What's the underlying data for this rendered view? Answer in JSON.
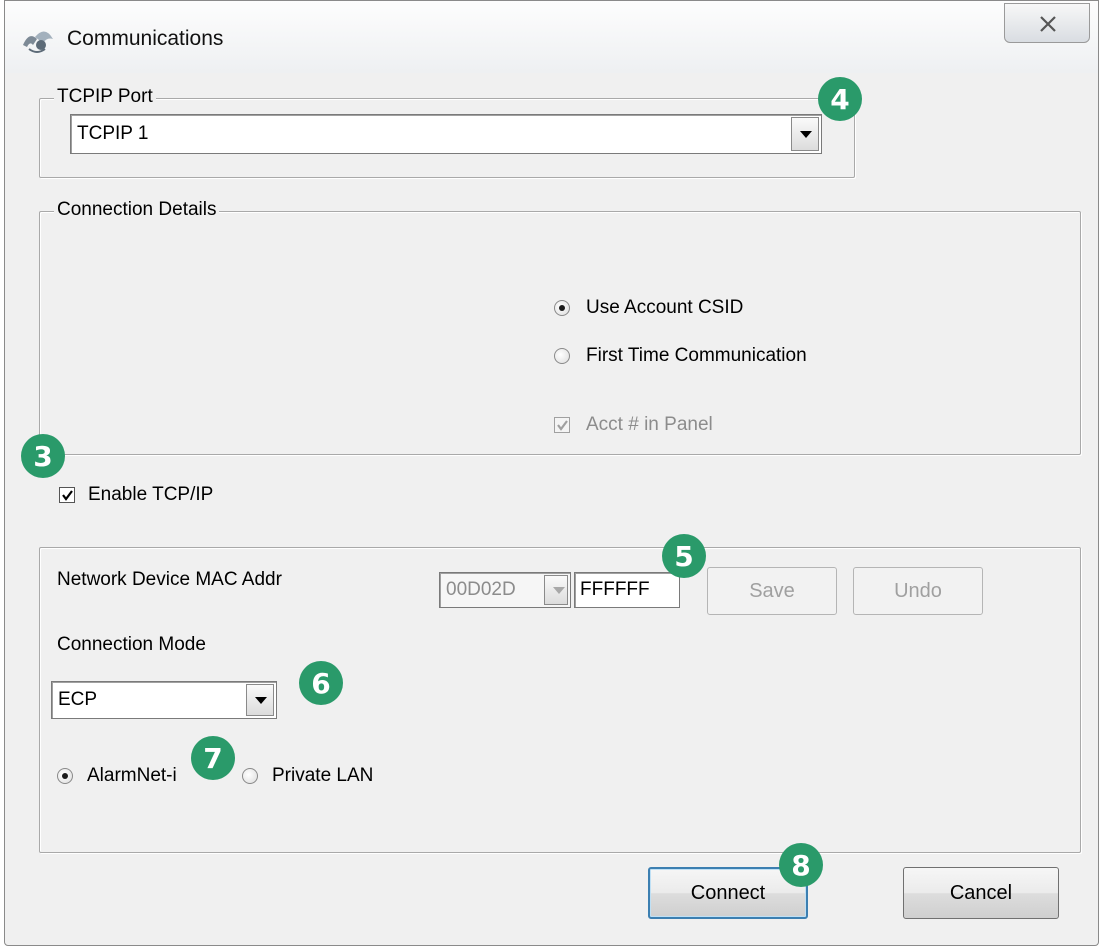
{
  "window": {
    "title": "Communications"
  },
  "tcpip_port": {
    "legend": "TCPIP Port",
    "selected": "TCPIP 1"
  },
  "connection_details": {
    "legend": "Connection Details",
    "radio_use_csid": "Use Account CSID",
    "radio_first_time": "First Time Communication",
    "check_acct_in_panel": "Acct # in Panel",
    "use_csid_selected": true,
    "acct_in_panel_checked": true
  },
  "enable_tcpip": {
    "label": "Enable TCP/IP",
    "checked": true
  },
  "network": {
    "mac_label": "Network Device MAC Addr",
    "mac_prefix": "00D02D",
    "mac_suffix": "FFFFFF",
    "save_label": "Save",
    "undo_label": "Undo",
    "connection_mode_label": "Connection Mode",
    "connection_mode_value": "ECP",
    "radio_alarmnet": "AlarmNet-i",
    "radio_private_lan": "Private LAN"
  },
  "footer": {
    "connect_label": "Connect",
    "cancel_label": "Cancel"
  },
  "callouts": [
    "3",
    "4",
    "5",
    "6",
    "7",
    "8"
  ],
  "colors": {
    "callout": "#2a9a6a",
    "default_button_border": "#3c7fb1"
  }
}
